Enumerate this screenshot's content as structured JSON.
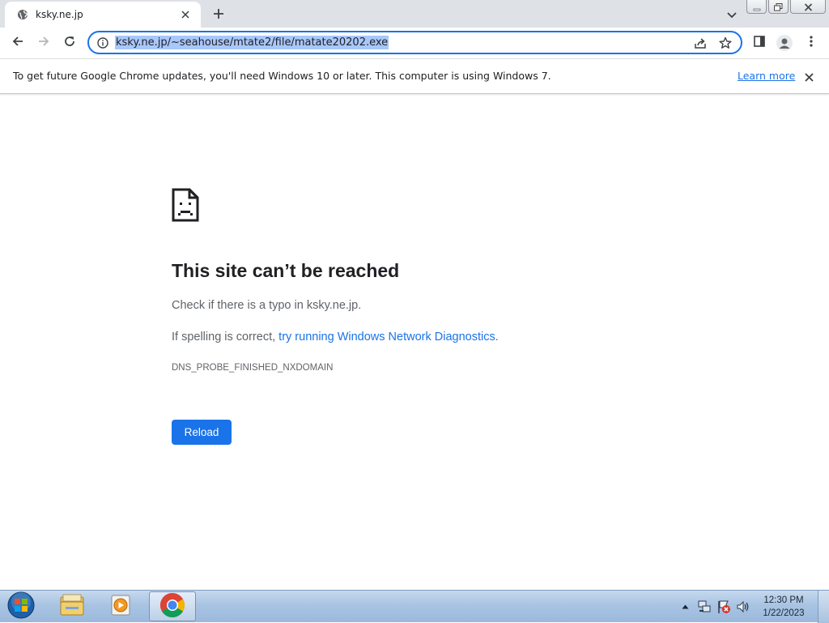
{
  "tab": {
    "title": "ksky.ne.jp",
    "favicon": "globe-icon"
  },
  "window_controls": [
    "minimize-icon",
    "restore-icon",
    "close-icon"
  ],
  "toolbar": {
    "url": "ksky.ne.jp/~seahouse/mtate2/file/matate20202.exe",
    "icons": [
      "back-arrow-icon",
      "forward-arrow-icon",
      "reload-icon",
      "info-icon",
      "share-icon",
      "star-icon",
      "side-panel-icon",
      "profile-icon",
      "kebab-menu-icon"
    ]
  },
  "infobar": {
    "message": "To get future Google Chrome updates, you'll need Windows 10 or later. This computer is using Windows 7.",
    "link": "Learn more"
  },
  "error_page": {
    "icon": "sad-document-icon",
    "heading": "This site can’t be reached",
    "line1": "Check if there is a typo in ksky.ne.jp.",
    "line2_prefix": "If spelling is correct, ",
    "line2_link": "try running Windows Network Diagnostics",
    "line2_suffix": ".",
    "error_code": "DNS_PROBE_FINISHED_NXDOMAIN",
    "reload_button": "Reload"
  },
  "taskbar": {
    "items": [
      "start-orb-icon",
      "file-explorer-icon",
      "media-player-icon",
      "chrome-icon"
    ],
    "tray_icons": [
      "show-hidden-icons-arrow",
      "network-icon",
      "action-center-flag-icon",
      "volume-icon"
    ],
    "time": "12:30 PM",
    "date": "1/22/2023"
  },
  "colors": {
    "accent": "#1a73e8",
    "url_selection": "#a8c7fa",
    "tabstrip": "#dee1e6"
  }
}
